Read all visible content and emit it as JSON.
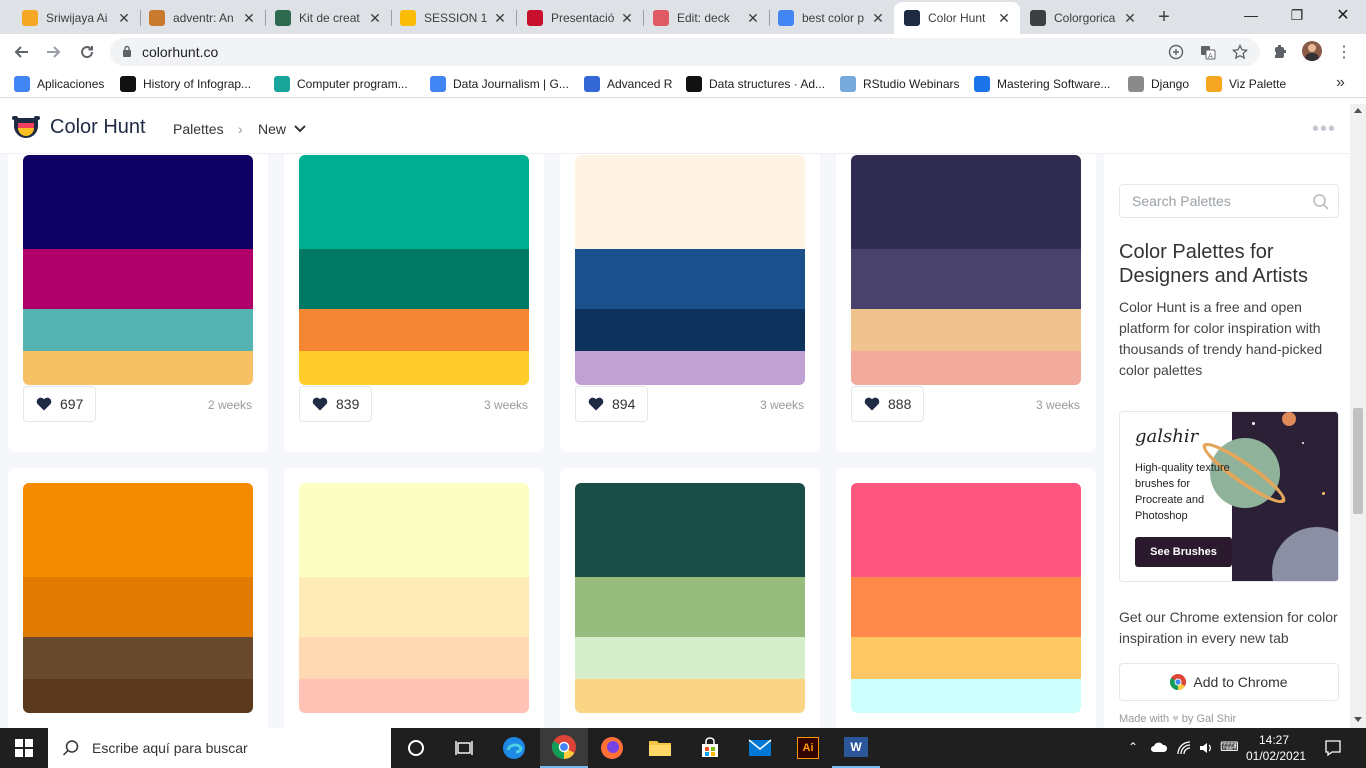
{
  "browser": {
    "tabs": [
      {
        "title": "Sriwijaya Ai",
        "icon": "orange-circle-icon",
        "color": "#f5a623"
      },
      {
        "title": "adventr: An",
        "icon": "fox-icon",
        "color": "#c87a2e"
      },
      {
        "title": "Kit de creat",
        "icon": "j-icon",
        "color": "#2d6a4f"
      },
      {
        "title": "SESSION 1:",
        "icon": "google-drive-icon",
        "color": "#fbbc04"
      },
      {
        "title": "Presentació",
        "icon": "presentation-icon",
        "color": "#c8102e"
      },
      {
        "title": "Edit: deck",
        "icon": "s-icon",
        "color": "#e05a66"
      },
      {
        "title": "best color p",
        "icon": "google-icon",
        "color": "#4285f4"
      },
      {
        "title": "Color Hunt",
        "icon": "colorhunt-icon",
        "color": "#1f2a44"
      },
      {
        "title": "Colorgorica",
        "icon": "globe-icon",
        "color": "#3c4043"
      }
    ],
    "url": "colorhunt.co",
    "bookmarks": [
      {
        "label": "Aplicaciones",
        "icon": "apps-icon"
      },
      {
        "label": "History of Infograp...",
        "icon": "i-icon"
      },
      {
        "label": "Computer program...",
        "icon": "hex-icon"
      },
      {
        "label": "Data Journalism | G...",
        "icon": "google-icon"
      },
      {
        "label": "Advanced R",
        "icon": "r-icon"
      },
      {
        "label": "Data structures · Ad...",
        "icon": "github-icon"
      },
      {
        "label": "RStudio Webinars",
        "icon": "r-icon"
      },
      {
        "label": "Mastering Software...",
        "icon": "infinity-icon"
      },
      {
        "label": "Django",
        "icon": "folder-icon"
      },
      {
        "label": "Viz Palette",
        "icon": "triangle-icon"
      }
    ]
  },
  "site": {
    "brand": "Color Hunt",
    "nav": {
      "palettes": "Palettes",
      "separator": "›",
      "new": "New"
    }
  },
  "palettes": [
    {
      "colors": [
        "#0f0064",
        "#af0069",
        "#55b3b1",
        "#f6c065"
      ],
      "likes": "697",
      "ago": "2 weeks"
    },
    {
      "colors": [
        "#00af91",
        "#007965",
        "#f58634",
        "#ffcc29"
      ],
      "likes": "839",
      "ago": "3 weeks"
    },
    {
      "colors": [
        "#fff3e6",
        "#1a508b",
        "#0d335d",
        "#c1a1d3"
      ],
      "likes": "894",
      "ago": "3 weeks"
    },
    {
      "colors": [
        "#312c51",
        "#48426d",
        "#f0c38e",
        "#f1aa9b"
      ],
      "likes": "888",
      "ago": "3 weeks"
    },
    {
      "colors": [
        "#f58b00",
        "#e07a00",
        "#694a2e",
        "#5a391c"
      ],
      "likes": "",
      "ago": ""
    },
    {
      "colors": [
        "#fcffc1",
        "#feebb8",
        "#ffd9b3",
        "#ffc2b5"
      ],
      "likes": "",
      "ago": ""
    },
    {
      "colors": [
        "#1a4d46",
        "#98bb7e",
        "#d5eec9",
        "#fad585"
      ],
      "likes": "",
      "ago": ""
    },
    {
      "colors": [
        "#ff577f",
        "#ff884b",
        "#ffc764",
        "#cdfffc"
      ],
      "likes": "",
      "ago": ""
    }
  ],
  "sidebar": {
    "search_placeholder": "Search Palettes",
    "title": "Color Palettes for Designers and Artists",
    "description": "Color Hunt is a free and open platform for color inspiration with thousands of trendy hand-picked color palettes",
    "ad": {
      "brand": "galshir",
      "text": "High-quality texture brushes for Procreate and Photoshop",
      "button": "See Brushes"
    },
    "extension_text": "Get our Chrome extension for color inspiration in every new tab",
    "chrome_button": "Add to Chrome",
    "made_with": "Made with",
    "made_by": "by Gal Shir"
  },
  "taskbar": {
    "search_placeholder": "Escribe aquí para buscar",
    "time": "14:27",
    "date": "01/02/2021"
  }
}
